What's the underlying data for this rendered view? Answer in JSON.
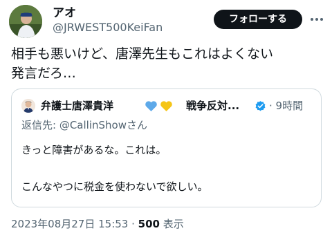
{
  "author": {
    "display_name": "アオ",
    "handle": "@JRWEST500KeiFan",
    "follow_label": "フォローする"
  },
  "tweet": {
    "line1": "相手も悪いけど、唐澤先生もこれはよくない",
    "line2": "発言だろ…"
  },
  "quoted": {
    "name": "弁護士唐澤貴洋",
    "name_suffix": "戦争反対...",
    "time": "· 9時間",
    "reply_prefix": "返信先: ",
    "reply_mention": "@CallinShowさん",
    "text_line1": "きっと障害があるな。これは。",
    "text_line2": "こんなやつに税金を使わないで欲しい。",
    "verified_color": "#1d9bf0"
  },
  "meta": {
    "timestamp": "2023年08月27日 15:53",
    "separator": " · ",
    "views_count": "500",
    "views_label": " 表示"
  },
  "icons": {
    "more": "more-dots-icon",
    "verified": "verified-badge-icon",
    "hearts": [
      "blue-heart-icon",
      "yellow-heart-icon"
    ]
  }
}
